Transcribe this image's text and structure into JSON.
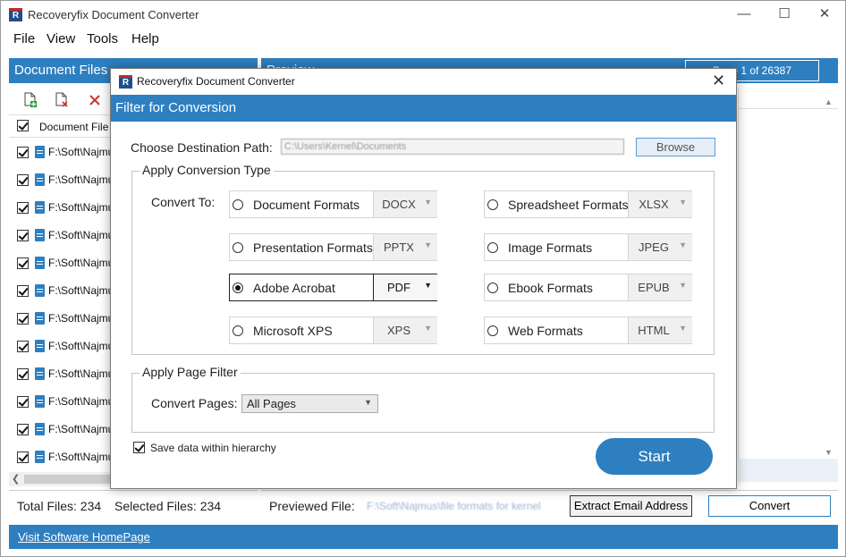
{
  "app": {
    "title": "Recoveryfix Document Converter",
    "logo_text": "R",
    "controls": {
      "minimize": "—",
      "maximize": "☐",
      "close": "✕"
    }
  },
  "menu": [
    "File",
    "View",
    "Tools",
    "Help"
  ],
  "left_panel": {
    "header": "Document Files",
    "column_header": "Document File",
    "rows": [
      "F:\\Soft\\Najmu",
      "F:\\Soft\\Najmu",
      "F:\\Soft\\Najmu",
      "F:\\Soft\\Najmu",
      "F:\\Soft\\Najmu",
      "F:\\Soft\\Najmu",
      "F:\\Soft\\Najmu",
      "F:\\Soft\\Najmu",
      "F:\\Soft\\Najmu",
      "F:\\Soft\\Najmu",
      "F:\\Soft\\Najmu",
      "F:\\Soft\\Najmu"
    ],
    "total_files": "Total Files: 234",
    "selected_files": "Selected Files: 234"
  },
  "right_panel": {
    "header": "Preview",
    "page_info": "Page 1 of 26387",
    "previewed_file_label": "Previewed File:",
    "previewed_file_value": "F:\\Soft\\Najmus\\file formats for kernel",
    "extract_button": "Extract Email Address",
    "convert_button": "Convert"
  },
  "footer": {
    "link": "Visit Software HomePage"
  },
  "dialog": {
    "title": "Recoveryfix Document Converter",
    "logo_text": "R",
    "close": "✕",
    "banner": "Filter for Conversion",
    "destination_label": "Choose Destination Path:",
    "destination_value": "C:\\Users\\Kernel\\Documents",
    "browse_button": "Browse",
    "conversion_group_title": "Apply Conversion Type",
    "convert_to_label": "Convert To:",
    "formats": [
      {
        "label": "Document Formats",
        "value": "DOCX",
        "selected": false
      },
      {
        "label": "Spreadsheet Formats",
        "value": "XLSX",
        "selected": false
      },
      {
        "label": "Presentation Formats",
        "value": "PPTX",
        "selected": false
      },
      {
        "label": "Image Formats",
        "value": "JPEG",
        "selected": false
      },
      {
        "label": "Adobe Acrobat",
        "value": "PDF",
        "selected": true
      },
      {
        "label": "Ebook Formats",
        "value": "EPUB",
        "selected": false
      },
      {
        "label": "Microsoft XPS",
        "value": "XPS",
        "selected": false
      },
      {
        "label": "Web Formats",
        "value": "HTML",
        "selected": false
      }
    ],
    "page_filter_group_title": "Apply Page Filter",
    "convert_pages_label": "Convert Pages:",
    "convert_pages_value": "All Pages",
    "save_hierarchy_label": "Save data within hierarchy",
    "start_button": "Start"
  },
  "colors": {
    "accent": "#2e7fc0",
    "logo": "#1f4e8c",
    "logo_stripe": "#c62828"
  }
}
